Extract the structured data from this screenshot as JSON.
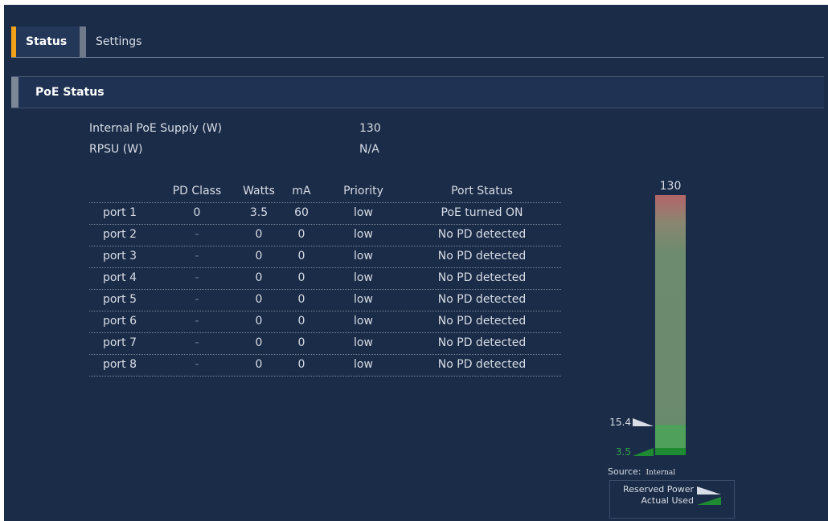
{
  "tabs": [
    {
      "label": "Status",
      "active": true
    },
    {
      "label": "Settings",
      "active": false
    }
  ],
  "section": {
    "title": "PoE Status"
  },
  "supply": [
    {
      "label": "Internal PoE Supply (W)",
      "value": "130"
    },
    {
      "label": "RPSU (W)",
      "value": "N/A"
    }
  ],
  "table": {
    "headers": [
      "",
      "PD Class",
      "Watts",
      "mA",
      "Priority",
      "Port Status"
    ],
    "rows": [
      [
        "port 1",
        "0",
        "3.5",
        "60",
        "low",
        "PoE turned ON"
      ],
      [
        "port 2",
        "-",
        "0",
        "0",
        "low",
        "No PD detected"
      ],
      [
        "port 3",
        "-",
        "0",
        "0",
        "low",
        "No PD detected"
      ],
      [
        "port 4",
        "-",
        "0",
        "0",
        "low",
        "No PD detected"
      ],
      [
        "port 5",
        "-",
        "0",
        "0",
        "low",
        "No PD detected"
      ],
      [
        "port 6",
        "-",
        "0",
        "0",
        "low",
        "No PD detected"
      ],
      [
        "port 7",
        "-",
        "0",
        "0",
        "low",
        "No PD detected"
      ],
      [
        "port 8",
        "-",
        "0",
        "0",
        "low",
        "No PD detected"
      ]
    ]
  },
  "power_bar": {
    "max_label": "130",
    "max": 130,
    "reserved": 15.4,
    "reserved_label": "15.4",
    "actual": 3.5,
    "actual_label": "3.5",
    "source_label": "Source:",
    "source_value": "Internal",
    "legend": {
      "reserved": "Reserved Power",
      "actual": "Actual Used"
    }
  },
  "colors": {
    "background": "#1b2c48",
    "tab_accent": "#f0a21b",
    "reserved": "#4fa05b",
    "actual": "#1e8a32"
  }
}
